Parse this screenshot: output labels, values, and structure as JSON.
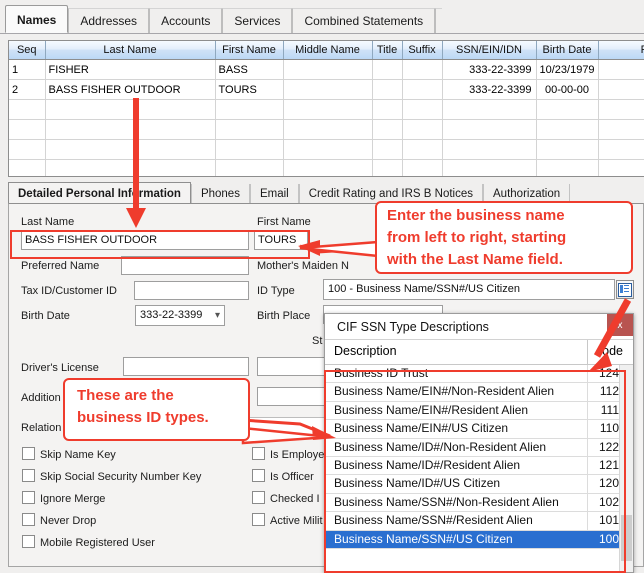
{
  "window": {
    "top_tabs": [
      {
        "label": "Names",
        "active": true
      },
      {
        "label": "Addresses",
        "active": false
      },
      {
        "label": "Accounts",
        "active": false
      },
      {
        "label": "Services",
        "active": false
      },
      {
        "label": "Combined Statements",
        "active": false
      }
    ]
  },
  "grid": {
    "columns": [
      "Seq",
      "Last Name",
      "First Name",
      "Middle Name",
      "Title",
      "Suffix",
      "SSN/EIN/IDN",
      "Birth Date",
      "Relat"
    ],
    "rows": [
      {
        "seq": "1",
        "last_name": "FISHER",
        "first_name": "BASS",
        "middle_name": "",
        "title": "",
        "suffix": "",
        "ssn": "333-22-3399",
        "birth_date": "10/23/1979",
        "relation": ""
      },
      {
        "seq": "2",
        "last_name": "BASS FISHER OUTDOOR",
        "first_name": "TOURS",
        "middle_name": "",
        "title": "",
        "suffix": "",
        "ssn": "333-22-3399",
        "birth_date": "00-00-00",
        "relation": ""
      },
      {
        "seq": "",
        "last_name": "",
        "first_name": "",
        "middle_name": "",
        "title": "",
        "suffix": "",
        "ssn": "",
        "birth_date": "",
        "relation": ""
      },
      {
        "seq": "",
        "last_name": "",
        "first_name": "",
        "middle_name": "",
        "title": "",
        "suffix": "",
        "ssn": "",
        "birth_date": "",
        "relation": ""
      },
      {
        "seq": "",
        "last_name": "",
        "first_name": "",
        "middle_name": "",
        "title": "",
        "suffix": "",
        "ssn": "",
        "birth_date": "",
        "relation": ""
      },
      {
        "seq": "",
        "last_name": "",
        "first_name": "",
        "middle_name": "",
        "title": "",
        "suffix": "",
        "ssn": "",
        "birth_date": "",
        "relation": ""
      }
    ]
  },
  "detail_tabs": [
    {
      "label": "Detailed Personal Information",
      "active": true
    },
    {
      "label": "Phones",
      "active": false
    },
    {
      "label": "Email",
      "active": false
    },
    {
      "label": "Credit Rating and IRS B Notices",
      "active": false
    },
    {
      "label": "Authorization",
      "active": false
    }
  ],
  "form": {
    "last_name_label": "Last Name",
    "last_name_value": "BASS FISHER OUTDOOR",
    "first_name_label": "First Name",
    "first_name_value": "TOURS",
    "preferred_name_label": "Preferred Name",
    "preferred_name_value": "",
    "mothers_maiden_label": "Mother's Maiden N",
    "mothers_maiden_value": "",
    "tax_id_label": "Tax ID/Customer ID",
    "tax_id_value": "",
    "id_type_label": "ID Type",
    "id_type_value": "100 - Business Name/SSN#/US Citizen",
    "birth_date_label": "Birth Date",
    "birth_date_value": "333-22-3399",
    "birth_place_label": "Birth Place",
    "birth_place_value": "",
    "state_label": "St",
    "drivers_license_label": "Driver's License",
    "drivers_license_value": "",
    "additional_label": "Addition",
    "additional_value": "",
    "relation_label": "Relation",
    "relation_value": "",
    "checkboxes_left": [
      {
        "label": "Skip Name Key",
        "checked": false
      },
      {
        "label": "Skip Social Security Number Key",
        "checked": false
      },
      {
        "label": "Ignore Merge",
        "checked": false
      },
      {
        "label": "Never Drop",
        "checked": false
      },
      {
        "label": "Mobile Registered User",
        "checked": false
      }
    ],
    "checkboxes_right": [
      {
        "label": "Is Employee",
        "checked": false
      },
      {
        "label": "Is Officer",
        "checked": false
      },
      {
        "label": "Checked I",
        "checked": false
      },
      {
        "label": "Active Milit",
        "checked": false
      }
    ]
  },
  "dialog": {
    "title": "CIF SSN Type Descriptions",
    "close_label": "x",
    "col_description": "Description",
    "col_code": "ode",
    "rows": [
      {
        "description": "Business ID Trust",
        "code": "124",
        "selected": false
      },
      {
        "description": "Business Name/EIN#/Non-Resident Alien",
        "code": "112",
        "selected": false
      },
      {
        "description": "Business Name/EIN#/Resident Alien",
        "code": "111",
        "selected": false
      },
      {
        "description": "Business Name/EIN#/US Citizen",
        "code": "110",
        "selected": false
      },
      {
        "description": "Business Name/ID#/Non-Resident Alien",
        "code": "122",
        "selected": false
      },
      {
        "description": "Business Name/ID#/Resident Alien",
        "code": "121",
        "selected": false
      },
      {
        "description": "Business Name/ID#/US Citizen",
        "code": "120",
        "selected": false
      },
      {
        "description": "Business Name/SSN#/Non-Resident Alien",
        "code": "102",
        "selected": false
      },
      {
        "description": "Business Name/SSN#/Resident Alien",
        "code": "101",
        "selected": false
      },
      {
        "description": "Business Name/SSN#/US Citizen",
        "code": "100",
        "selected": true
      }
    ]
  },
  "annotations": {
    "accent_color": "#ef3c2d",
    "callout_1_line1": "Enter the business name",
    "callout_1_line2": "from left to right, starting",
    "callout_1_line3": "with the Last Name field.",
    "callout_2_line1": "These are the",
    "callout_2_line2": "business ID types."
  }
}
